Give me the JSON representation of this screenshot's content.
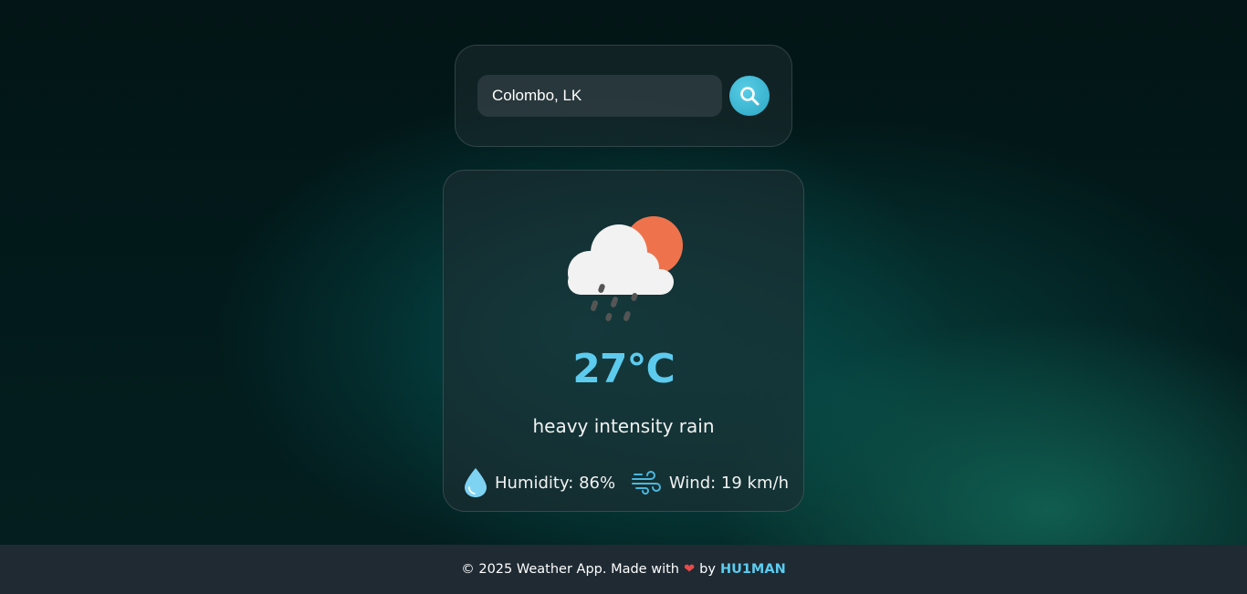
{
  "search": {
    "value": "Colombo, LK",
    "icon": "search-icon"
  },
  "weather": {
    "icon": "cloud-sun-rain-icon",
    "temperature": "27°C",
    "description": "heavy intensity rain",
    "humidity_label": "Humidity: 86%",
    "wind_label": "Wind: 19 km/h",
    "humidity_icon": "water-drop-icon",
    "wind_icon": "wind-icon"
  },
  "footer": {
    "prefix": "© 2025 Weather App. Made with",
    "heart": "❤",
    "by": "by",
    "author": "HU1MAN"
  },
  "colors": {
    "accent": "#5ccbee",
    "heart": "#e84a4a",
    "sun": "#ee734c"
  }
}
